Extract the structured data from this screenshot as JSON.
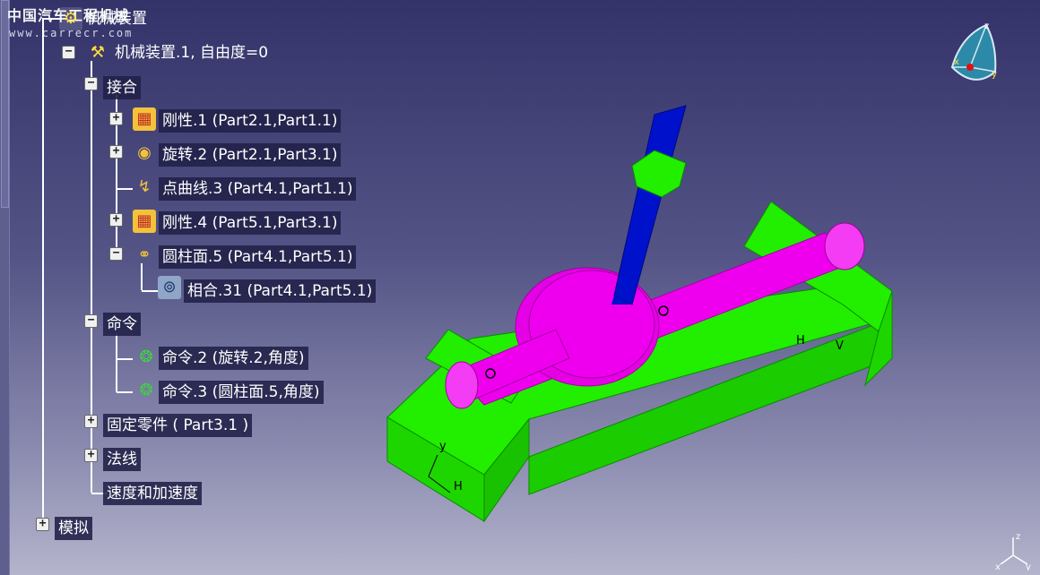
{
  "watermark": {
    "title": "中国汽车工程机械",
    "url": "www.carrecr.com"
  },
  "tree": {
    "root": {
      "label": "机械装置",
      "icon": "mechanism-root-icon"
    },
    "mechanism": {
      "label": "机械装置.1, 自由度=0",
      "icon": "mechanism-icon"
    },
    "joints": {
      "label": "接合",
      "items": [
        {
          "label": "刚性.1 (Part2.1,Part1.1)",
          "icon": "rigid-joint-icon"
        },
        {
          "label": "旋转.2 (Part2.1,Part3.1)",
          "icon": "revolute-joint-icon"
        },
        {
          "label": "点曲线.3 (Part4.1,Part1.1)",
          "icon": "point-curve-joint-icon"
        },
        {
          "label": "刚性.4 (Part5.1,Part3.1)",
          "icon": "rigid-joint-icon"
        },
        {
          "label": "圆柱面.5 (Part4.1,Part5.1)",
          "icon": "cylindrical-joint-icon"
        },
        {
          "label": "相合.31 (Part4.1,Part5.1)",
          "icon": "coincidence-constraint-icon"
        }
      ]
    },
    "commands": {
      "label": "命令",
      "items": [
        {
          "label": "命令.2 (旋转.2,角度)",
          "icon": "angle-command-icon"
        },
        {
          "label": "命令.3 (圆柱面.5,角度)",
          "icon": "angle-command-icon"
        }
      ]
    },
    "fixed_part": {
      "label": "固定零件 ( Part3.1 )"
    },
    "laws": {
      "label": "法线"
    },
    "speeds": {
      "label": "速度和加速度"
    },
    "simulation": {
      "label": "模拟"
    }
  },
  "compass_axes": {
    "x": "x",
    "y": "y",
    "z": "z"
  },
  "model_labels": {
    "axis_h": "H",
    "axis_v": "V",
    "axis_y": "y"
  },
  "colors": {
    "base_green": "#22ee00",
    "shaft_magenta": "#ee00ee",
    "pen_blue": "#0011cc",
    "slider_green": "#22ee00"
  }
}
